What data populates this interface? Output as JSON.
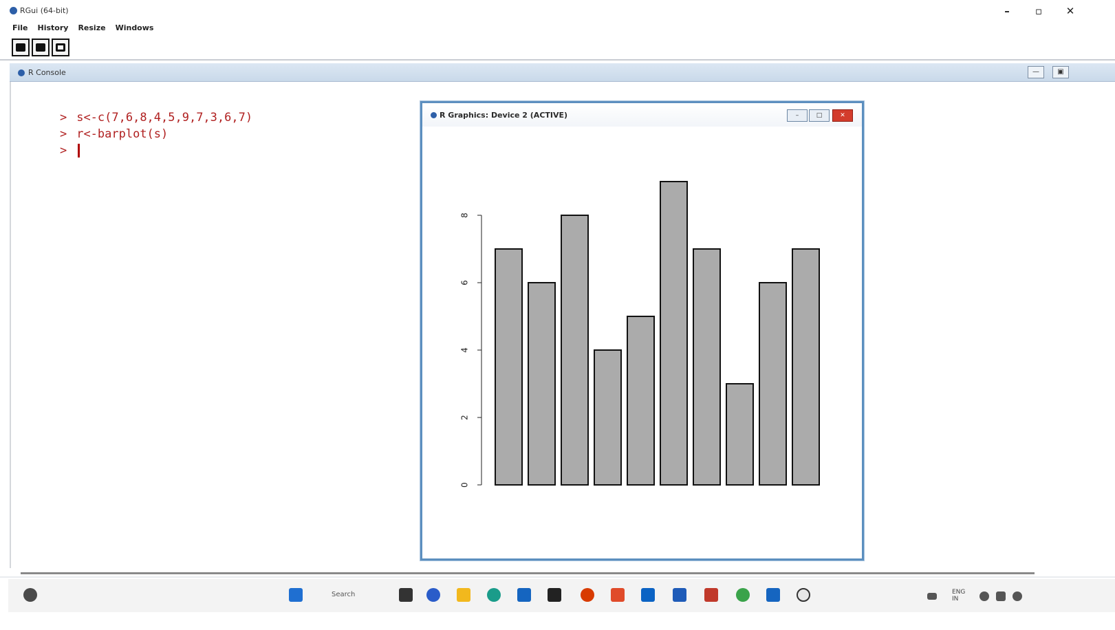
{
  "app": {
    "title": "RGui (64-bit)"
  },
  "window_controls": {
    "minimize": "–",
    "maximize": "▫",
    "close": "✕"
  },
  "menu": [
    "File",
    "History",
    "Resize",
    "Windows"
  ],
  "toolbar": [
    "open-script",
    "print",
    "stop"
  ],
  "console": {
    "title": "R Console",
    "lines": [
      {
        "prompt": ">",
        "text": "s<-c(7,6,8,4,5,9,7,3,6,7)"
      },
      {
        "prompt": ">",
        "text": "r<-barplot(s)"
      },
      {
        "prompt": ">",
        "text": ""
      }
    ]
  },
  "graphics": {
    "title": "R Graphics: Device 2 (ACTIVE)",
    "controls": {
      "minimize": "–",
      "maximize": "□",
      "close": "✕"
    }
  },
  "chart_data": {
    "type": "bar",
    "values": [
      7,
      6,
      8,
      4,
      5,
      9,
      7,
      3,
      6,
      7
    ],
    "ylim": [
      0,
      9
    ],
    "yticks": [
      "0",
      "2",
      "4",
      "6",
      "8"
    ],
    "bar_color": "#ababab",
    "title": "",
    "xlabel": "",
    "ylabel": ""
  },
  "taskbar": {
    "search": "Search",
    "tray_lang": "ENG",
    "tray_region": "IN"
  }
}
